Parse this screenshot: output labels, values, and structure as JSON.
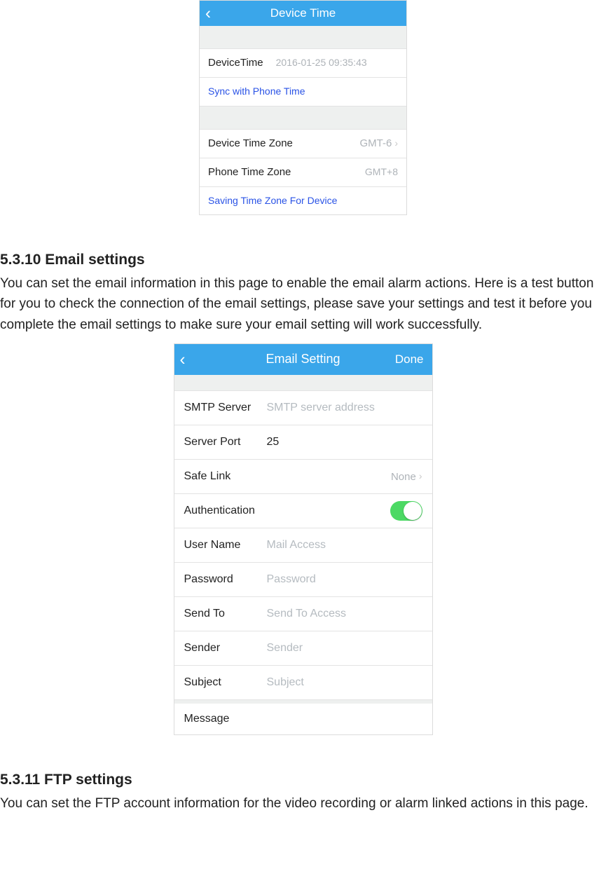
{
  "device_time": {
    "nav_title": "Device Time",
    "row_device_time_label": "DeviceTime",
    "row_device_time_value": "2016-01-25  09:35:43",
    "sync_link": "Sync with Phone Time",
    "row_dtz_label": "Device Time Zone",
    "row_dtz_value": "GMT-6",
    "row_ptz_label": "Phone Time Zone",
    "row_ptz_value": "GMT+8",
    "save_tz_link": "Saving Time Zone For Device"
  },
  "sec_email": {
    "heading": "5.3.10 Email settings",
    "paragraph": "You can set the email information in this page to enable the email alarm actions. Here is a test button for you to check the connection of the email settings, please save your settings and test it before you complete the email settings to make sure your email setting will work successfully."
  },
  "email": {
    "nav_title": "Email Setting",
    "done_label": "Done",
    "smtp_label": "SMTP Server",
    "smtp_placeholder": "SMTP server address",
    "port_label": "Server Port",
    "port_value": "25",
    "safe_label": "Safe Link",
    "safe_value": "None",
    "auth_label": "Authentication",
    "user_label": "User Name",
    "user_placeholder": "Mail Access",
    "pass_label": "Password",
    "pass_placeholder": "Password",
    "sendto_label": "Send To",
    "sendto_placeholder": "Send To Access",
    "sender_label": "Sender",
    "sender_placeholder": "Sender",
    "subject_label": "Subject",
    "subject_placeholder": "Subject",
    "message_label": "Message"
  },
  "sec_ftp": {
    "heading": "5.3.11 FTP settings",
    "paragraph": "You can set the FTP account information for the video recording or alarm linked actions in this page."
  }
}
